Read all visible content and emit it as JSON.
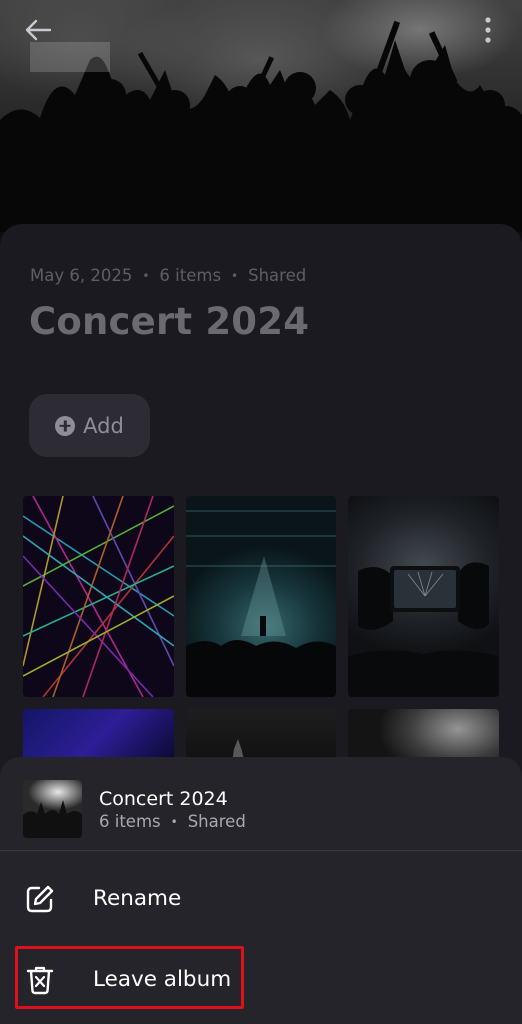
{
  "header": {
    "back_icon": "arrow-left-icon",
    "more_icon": "more-vertical-icon"
  },
  "album": {
    "date": "May 6, 2025",
    "items": "6 items",
    "status": "Shared",
    "separator": "•",
    "title": "Concert 2024",
    "add_label": "Add"
  },
  "photos": [
    {
      "name": "laser-show"
    },
    {
      "name": "stage-lights"
    },
    {
      "name": "phone-recording"
    },
    {
      "name": "blue-stage"
    },
    {
      "name": "dark-crowd"
    },
    {
      "name": "bright-lights"
    }
  ],
  "sheet": {
    "title": "Concert 2024",
    "items": "6 items",
    "status": "Shared",
    "separator": "•",
    "menu": [
      {
        "label": "Rename",
        "icon": "edit-icon"
      },
      {
        "label": "Leave album",
        "icon": "trash-x-icon"
      }
    ]
  },
  "colors": {
    "background": "#0e0e12",
    "panel": "#1b1a20",
    "sheet": "#25242b",
    "highlight": "#e0101a"
  }
}
